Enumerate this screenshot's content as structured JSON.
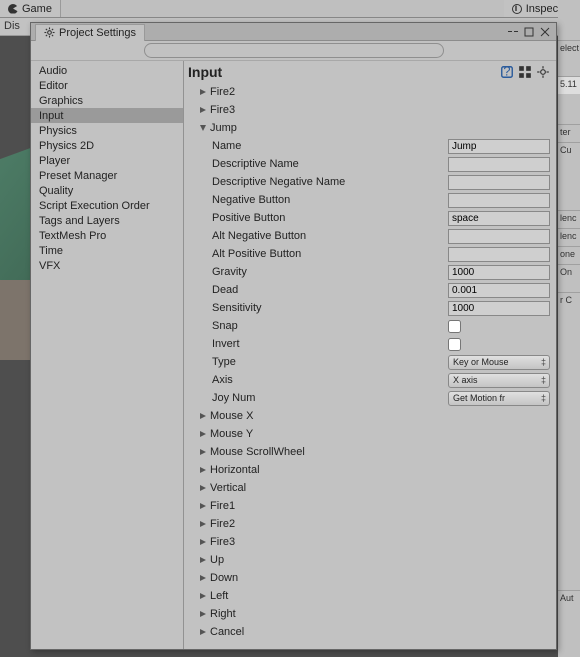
{
  "bg_tabs": {
    "game": "Game",
    "inspector": "Inspector"
  },
  "under": {
    "dis": "Dis"
  },
  "window": {
    "title": "Project Settings",
    "search_placeholder": ""
  },
  "sidebar": {
    "items": [
      "Audio",
      "Editor",
      "Graphics",
      "Input",
      "Physics",
      "Physics 2D",
      "Player",
      "Preset Manager",
      "Quality",
      "Script Execution Order",
      "Tags and Layers",
      "TextMesh Pro",
      "Time",
      "VFX"
    ],
    "selected_index": 3
  },
  "main": {
    "heading": "Input",
    "axes_above": [
      "Fire2",
      "Fire3"
    ],
    "expanded_axis": "Jump",
    "props": {
      "Name": "Jump",
      "Descriptive Name": "",
      "Descriptive Negative Name": "",
      "Negative Button": "",
      "Positive Button": "space",
      "Alt Negative Button": "",
      "Alt Positive Button": "",
      "Gravity": "1000",
      "Dead": "0.001",
      "Sensitivity": "1000",
      "Snap": false,
      "Invert": false,
      "Type": "Key or Mouse",
      "Axis": "X axis",
      "Joy Num": "Get Motion fr"
    },
    "prop_labels": {
      "Name": "Name",
      "DescName": "Descriptive Name",
      "DescNeg": "Descriptive Negative Name",
      "NegBtn": "Negative Button",
      "PosBtn": "Positive Button",
      "AltNeg": "Alt Negative Button",
      "AltPos": "Alt Positive Button",
      "Gravity": "Gravity",
      "Dead": "Dead",
      "Sensitivity": "Sensitivity",
      "Snap": "Snap",
      "Invert": "Invert",
      "Type": "Type",
      "Axis": "Axis",
      "JoyNum": "Joy Num"
    },
    "axes_below": [
      "Mouse X",
      "Mouse Y",
      "Mouse ScrollWheel",
      "Horizontal",
      "Vertical",
      "Fire1",
      "Fire2",
      "Fire3",
      "Up",
      "Down",
      "Left",
      "Right",
      "Cancel"
    ]
  },
  "peek": {
    "rows": [
      "elect",
      "",
      "5.11",
      "",
      "ter",
      "Cu",
      "",
      "",
      "",
      "",
      "",
      "lenc",
      "lenc",
      "one",
      "On",
      "",
      "r C",
      "",
      "",
      "",
      "",
      "",
      "",
      "",
      "",
      "",
      "",
      "",
      "",
      "",
      "",
      "",
      "Aut"
    ]
  }
}
